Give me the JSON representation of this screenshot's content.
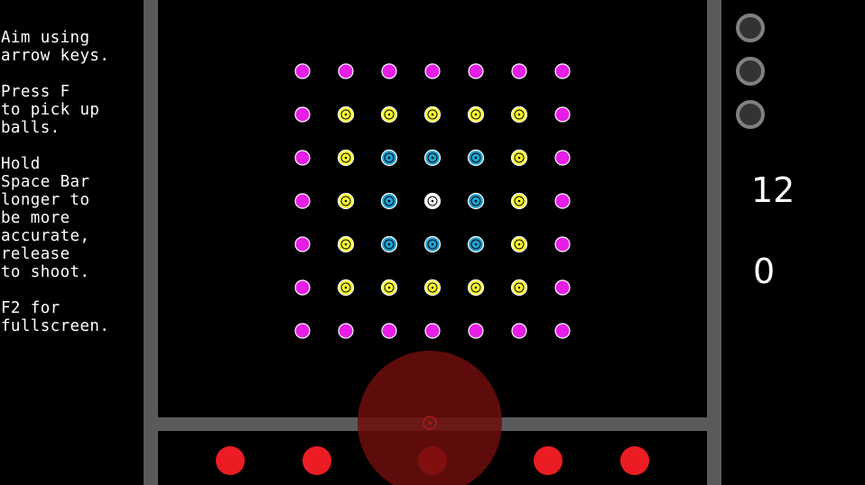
{
  "instructions": {
    "aim": "Aim using\narrow keys.",
    "pickup": "Press F\nto pick up\nballs.",
    "shoot": "Hold\nSpace Bar\nlonger to\nbe more\naccurate,\nrelease\nto shoot.",
    "fullscreen": "F2 for\nfullscreen."
  },
  "hud": {
    "score": "12",
    "count": "0",
    "life_slots": 3
  },
  "board": {
    "rows": [
      [
        "magenta",
        "magenta",
        "magenta",
        "magenta",
        "magenta",
        "magenta",
        "magenta"
      ],
      [
        "magenta",
        "yellow",
        "yellow",
        "yellow",
        "yellow",
        "yellow",
        "magenta"
      ],
      [
        "magenta",
        "yellow",
        "cyan",
        "cyan",
        "cyan",
        "yellow",
        "magenta"
      ],
      [
        "magenta",
        "yellow",
        "cyan",
        "white",
        "cyan",
        "yellow",
        "magenta"
      ],
      [
        "magenta",
        "yellow",
        "cyan",
        "cyan",
        "cyan",
        "yellow",
        "magenta"
      ],
      [
        "magenta",
        "yellow",
        "yellow",
        "yellow",
        "yellow",
        "yellow",
        "magenta"
      ],
      [
        "magenta",
        "magenta",
        "magenta",
        "magenta",
        "magenta",
        "magenta",
        "magenta"
      ]
    ]
  },
  "tray_balls": 5,
  "colors": {
    "magenta": "#e61ee6",
    "yellow": "#ffff33",
    "cyan": "#1fa3d2",
    "white": "#ffffff",
    "red_ball": "#ec1c24",
    "aim_circle": "#6e0d0d",
    "wall": "#5a5a5a",
    "slot_ring": "#808080",
    "slot_fill": "#333333",
    "background": "#000000"
  }
}
